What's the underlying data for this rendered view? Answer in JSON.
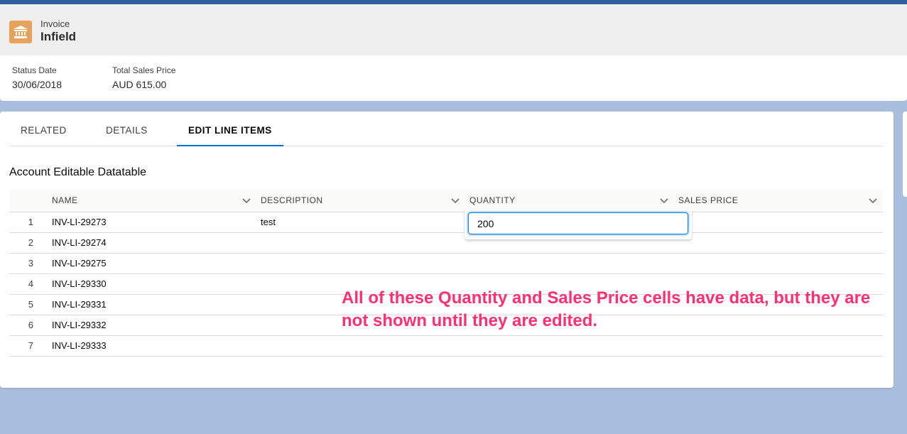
{
  "record": {
    "object_type": "Invoice",
    "title": "Infield",
    "icon": "bank-icon",
    "icon_color": "#e8a25c"
  },
  "highlights": [
    {
      "label": "Status Date",
      "value": "30/06/2018"
    },
    {
      "label": "Total Sales Price",
      "value": "AUD 615.00"
    }
  ],
  "tabs": [
    {
      "label": "RELATED"
    },
    {
      "label": "DETAILS"
    },
    {
      "label": "EDIT LINE ITEMS",
      "active": true
    }
  ],
  "datatable": {
    "title": "Account Editable Datatable",
    "columns": [
      "NAME",
      "DESCRIPTION",
      "QUANTITY",
      "SALES PRICE"
    ],
    "rows": [
      {
        "num": "1",
        "name": "INV-LI-29273",
        "description": "test"
      },
      {
        "num": "2",
        "name": "INV-LI-29274",
        "description": ""
      },
      {
        "num": "3",
        "name": "INV-LI-29275",
        "description": ""
      },
      {
        "num": "4",
        "name": "INV-LI-29330",
        "description": ""
      },
      {
        "num": "5",
        "name": "INV-LI-29331",
        "description": ""
      },
      {
        "num": "6",
        "name": "INV-LI-29332",
        "description": ""
      },
      {
        "num": "7",
        "name": "INV-LI-29333",
        "description": ""
      }
    ],
    "editor_value": "200"
  },
  "annotation": "All of these Quantity and Sales Price cells have data, but they are not shown until they are edited."
}
